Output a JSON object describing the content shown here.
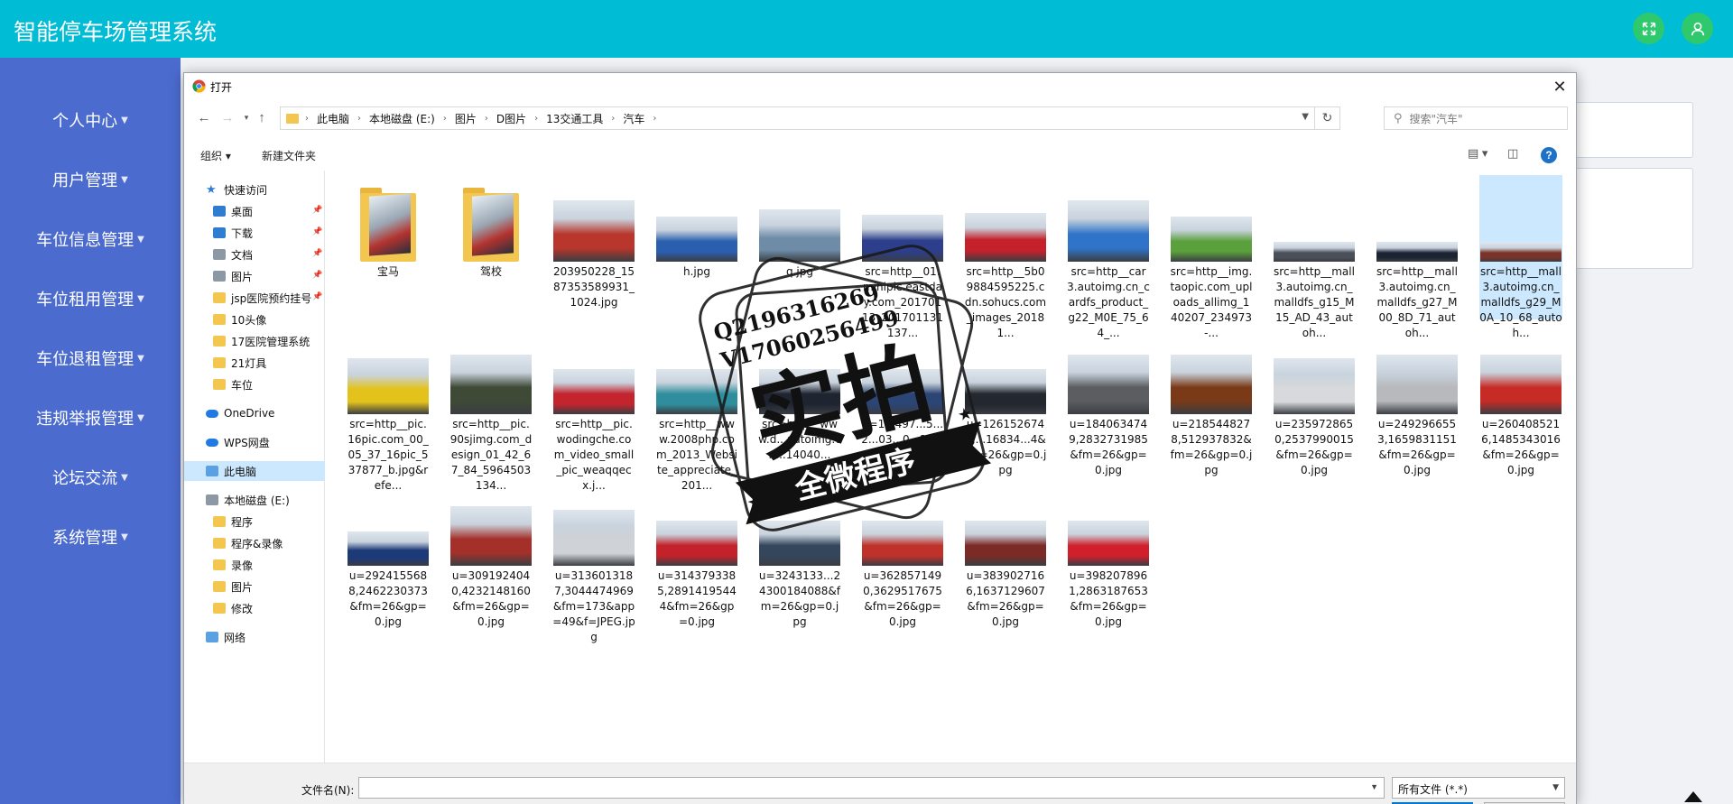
{
  "app": {
    "title": "智能停车场管理系统"
  },
  "sidebar": {
    "items": [
      {
        "label": "个人中心"
      },
      {
        "label": "用户管理"
      },
      {
        "label": "车位信息管理"
      },
      {
        "label": "车位租用管理"
      },
      {
        "label": "车位退租管理"
      },
      {
        "label": "违规举报管理"
      },
      {
        "label": "论坛交流"
      },
      {
        "label": "系统管理"
      }
    ]
  },
  "dialog": {
    "title": "打开",
    "breadcrumb": [
      "此电脑",
      "本地磁盘 (E:)",
      "图片",
      "D图片",
      "13交通工具",
      "汽车"
    ],
    "search_placeholder": "搜索\"汽车\"",
    "organize_label": "组织 ▾",
    "new_folder_label": "新建文件夹",
    "filename_label": "文件名(N):",
    "filename_value": "",
    "filetype_value": "所有文件 (*.*)"
  },
  "navpane": {
    "items": [
      {
        "label": "快速访问",
        "icon": "star-icon"
      },
      {
        "label": "桌面",
        "icon": "desktop-icon"
      },
      {
        "label": "下载",
        "icon": "download-icon"
      },
      {
        "label": "文档",
        "icon": "document-icon"
      },
      {
        "label": "图片",
        "icon": "pictures-icon"
      },
      {
        "label": "jsp医院预约挂号",
        "icon": "folder-icon"
      },
      {
        "label": "10头像",
        "icon": "folder-icon"
      },
      {
        "label": "17医院管理系统",
        "icon": "folder-icon"
      },
      {
        "label": "21灯具",
        "icon": "folder-icon"
      },
      {
        "label": "车位",
        "icon": "folder-icon"
      },
      {
        "label": "OneDrive",
        "icon": "cloud-icon"
      },
      {
        "label": "WPS网盘",
        "icon": "cloud-icon"
      },
      {
        "label": "此电脑",
        "icon": "computer-icon"
      },
      {
        "label": "本地磁盘 (E:)",
        "icon": "drive-icon"
      },
      {
        "label": "程序",
        "icon": "folder-icon"
      },
      {
        "label": "程序&录像",
        "icon": "folder-icon"
      },
      {
        "label": "录像",
        "icon": "folder-icon"
      },
      {
        "label": "图片",
        "icon": "folder-icon"
      },
      {
        "label": "修改",
        "icon": "folder-icon"
      },
      {
        "label": "网络",
        "icon": "network-icon"
      }
    ]
  },
  "files": [
    {
      "name": "宝马",
      "kind": "folder"
    },
    {
      "name": "驾校",
      "kind": "folder"
    },
    {
      "name": "203950228_1587353589931_1024.jpg",
      "color": "#b8362b"
    },
    {
      "name": "h.jpg",
      "color": "#2a5fb0"
    },
    {
      "name": "q.jpg",
      "color": "#6e8ca8"
    },
    {
      "name": "src=http__01.minipic.eastday.com_20170113_20170113113​7...",
      "color": "#2c3e8c"
    },
    {
      "name": "src=http__5b09884595225.cdn.sohucs.com_images_20181...",
      "color": "#c4212b"
    },
    {
      "name": "src=http__car3.autoimg.cn_cardfs_product_g22_M0E_75_64_...",
      "color": "#2f74c9"
    },
    {
      "name": "src=http__img.taopic.com_uploads_allimg_140207_234973-...",
      "color": "#5aa03c"
    },
    {
      "name": "src=http__mall3.autoimg.cn_malldfs_g15_M15_AD_43_autoh...",
      "color": "#4a4f5a"
    },
    {
      "name": "src=http__mall3.autoimg.cn_malldfs_g27_M00_8D_71_autoh...",
      "color": "#1c2433"
    },
    {
      "name": "src=http__mall3.autoimg.cn_malldfs_g29_M0A_10_68_autoh...",
      "color": "#7a3328",
      "selected": true
    },
    {
      "name": "src=http__pic.16pic.com_00_05_37_16pic_537877_b.jpg&refe...",
      "color": "#e3c21c"
    },
    {
      "name": "src=http__pic.90sjimg.com_design_01_42_67_84_5964503134...",
      "color": "#3f4a36"
    },
    {
      "name": "src=http__pic.wodingche.com_video_small_pic_weaqqecx.j...",
      "color": "#c3242e"
    },
    {
      "name": "src=http__www.2008php.com_2013_Website_appreciate_201...",
      "color": "#2f8e9e"
    },
    {
      "name": "src=http__www.d...autoimg.cn...14040...",
      "color": "#1f2431"
    },
    {
      "name": "u=1...497...5...2...03...0...26...=0.jpg",
      "color": "#2b4575"
    },
    {
      "name": "u=1261526742,...16834...4&fm=26&gp=0.jpg",
      "color": "#23272e"
    },
    {
      "name": "u=1840634749,2832731985&fm=26&gp=0.jpg",
      "color": "#5b5d60"
    },
    {
      "name": "u=2185448278,512937832&fm=26&gp=0.jpg",
      "color": "#7a3a18"
    },
    {
      "name": "u=2359728650,2537990015&fm=26&gp=0.jpg",
      "color": "#d7d9dc"
    },
    {
      "name": "u=2492966553,1659831151&fm=26&gp=0.jpg",
      "color": "#b7b9bd"
    },
    {
      "name": "u=2604085216,1485343016&fm=26&gp=0.jpg",
      "color": "#c72b25"
    },
    {
      "name": "u=2924155688,2462230373&fm=26&gp=0.jpg",
      "color": "#1d3a78"
    },
    {
      "name": "u=3091924040,4232148160&fm=26&gp=0.jpg",
      "color": "#a5302a"
    },
    {
      "name": "u=3136013187,3044474969&fm=173&app=49&f=JPEG.jpg",
      "color": "#cfd2d6"
    },
    {
      "name": "u=3143793385,28914195444&fm=26&gp=0.jpg",
      "color": "#c3222a"
    },
    {
      "name": "u=3243133...24300184088&fm=26&gp=0.jpg",
      "color": "#34465c"
    },
    {
      "name": "u=3628571490,3629517675&fm=26&gp=0.jpg",
      "color": "#c0312b"
    },
    {
      "name": "u=3839027166,1637129607&fm=26&gp=0.jpg",
      "color": "#7c2a26"
    },
    {
      "name": "u=3982078961,2863187653&fm=26&gp=0.jpg",
      "color": "#d1202c"
    }
  ],
  "watermark": {
    "line1": "Q2196316269",
    "line2": "V17060256499",
    "main": "实拍",
    "ribbon": "全微程序"
  },
  "colors": {
    "topbar": "#00bcd4",
    "sidebar": "#4b6bcf",
    "topbar_buttons": "#2fc96d",
    "selection": "#cce8ff"
  }
}
